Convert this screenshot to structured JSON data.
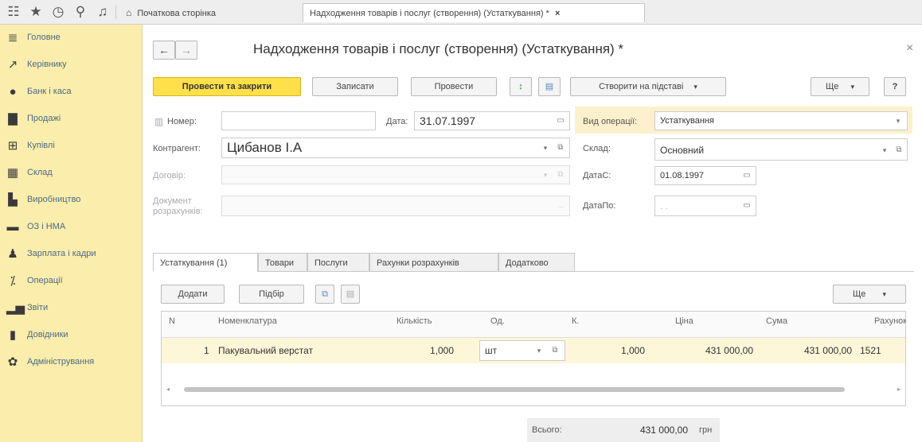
{
  "topbar": {
    "icons": [
      "grid-icon",
      "star-icon",
      "history-icon",
      "search-icon",
      "bell-icon"
    ],
    "home_tab": "Початкова сторінка",
    "active_tab": "Надходження товарів і послуг (створення) (Устаткування) *",
    "tab_close": "×"
  },
  "sidebar": {
    "items": [
      {
        "label": "Головне",
        "icon": "menu-lines-icon"
      },
      {
        "label": "Керівнику",
        "icon": "trend-icon"
      },
      {
        "label": "Банк і каса",
        "icon": "coin-icon"
      },
      {
        "label": "Продажі",
        "icon": "bag-icon"
      },
      {
        "label": "Купівлі",
        "icon": "cart-icon"
      },
      {
        "label": "Склад",
        "icon": "boxes-icon"
      },
      {
        "label": "Виробництво",
        "icon": "factory-icon"
      },
      {
        "label": "ОЗ і НМА",
        "icon": "truck-icon"
      },
      {
        "label": "Зарплата і кадри",
        "icon": "person-icon"
      },
      {
        "label": "Операції",
        "icon": "operations-icon"
      },
      {
        "label": "Звіти",
        "icon": "chart-icon"
      },
      {
        "label": "Довідники",
        "icon": "book-icon"
      },
      {
        "label": "Адміністрування",
        "icon": "gear-icon"
      }
    ]
  },
  "form": {
    "title": "Надходження товарів і послуг (створення) (Устаткування) *",
    "close": "×",
    "nav_back": "←",
    "nav_fwd": "→",
    "toolbar": {
      "post_close": "Провести та закрити",
      "save": "Записати",
      "post": "Провести",
      "create_based": "Створити на підставі",
      "more": "Ще",
      "help": "?"
    },
    "fields": {
      "number_label": "Номер:",
      "number_value": "",
      "date_label": "Дата:",
      "date_value": "31.07.1997",
      "op_type_label": "Вид операції:",
      "op_type_value": "Устаткування",
      "counterparty_label": "Контрагент:",
      "counterparty_value": "Цибанов І.А",
      "warehouse_label": "Склад:",
      "warehouse_value": "Основний",
      "contract_label": "Договір:",
      "dates_label": "ДатаС:",
      "dates_value": "01.08.1997",
      "doc_label_1": "Документ",
      "doc_label_2": "розрахунків:",
      "datepo_label": "ДатаПо:",
      "datepo_value": ". .",
      "ellipsis": "..."
    },
    "tabs": [
      "Устаткування (1)",
      "Товари",
      "Послуги",
      "Рахунки розрахунків",
      "Додатково"
    ],
    "table_toolbar": {
      "add": "Додати",
      "pick": "Підбір",
      "more": "Ще"
    },
    "table": {
      "headers": [
        "N",
        "Номенклатура",
        "Кількість",
        "Од.",
        "К.",
        "Ціна",
        "Сума",
        "Рахунок"
      ],
      "rows": [
        {
          "n": "1",
          "item": "Пакувальний верстат",
          "qty": "1,000",
          "unit": "шт",
          "k": "1,000",
          "price": "431 000,00",
          "sum": "431 000,00",
          "account": "1521"
        }
      ]
    },
    "total": {
      "label": "Всього:",
      "value": "431 000,00",
      "currency": "грн"
    }
  },
  "colors": {
    "sidebar_bg": "#fbedab",
    "primary_button": "#ffe04a",
    "selected_row": "#fdf6d8"
  }
}
